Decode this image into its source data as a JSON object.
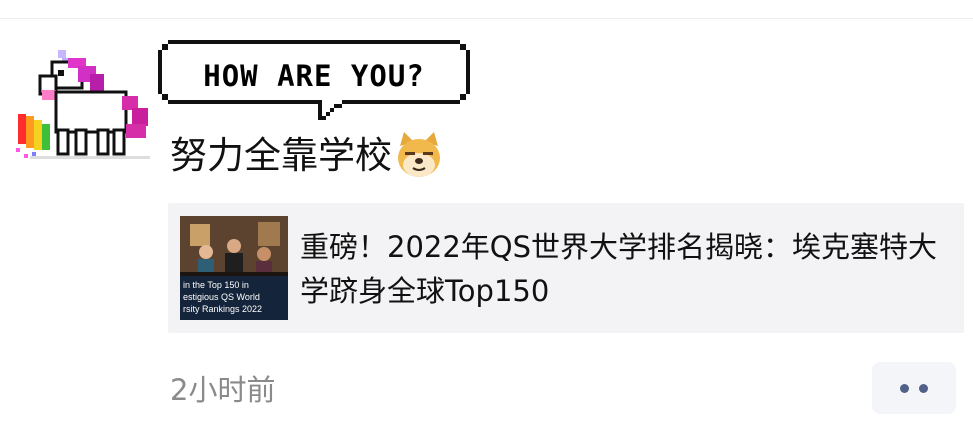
{
  "post": {
    "avatar_icon": "pixel-unicorn-rainbow-icon",
    "bubble_text": "HOW ARE YOU?",
    "text": "努力全靠学校",
    "emoji": "doge-icon",
    "time": "2小时前"
  },
  "link_card": {
    "title": "重磅！2022年QS世界大学排名揭晓：埃克塞特大学跻身全球Top150",
    "thumbnail_lines": [
      "in the Top 150 in",
      "estigious QS World",
      "rsity Rankings 2022"
    ]
  },
  "more_button": {
    "icon": "more-dots-icon"
  },
  "colors": {
    "accent_dots": "#506088",
    "card_bg": "#f3f3f5",
    "time_text": "#8a8a8a",
    "unicorn_mane": "#d22fc5",
    "unicorn_tail": "#d52ea8"
  }
}
